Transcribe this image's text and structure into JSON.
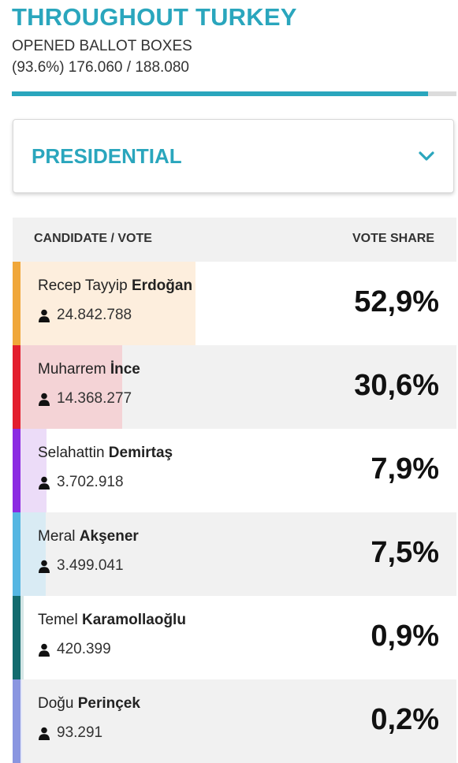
{
  "header": {
    "title": "THROUGHOUT TURKEY",
    "subtitle": "OPENED BALLOT BOXES",
    "counts": "(93.6%) 176.060 / 188.080",
    "progress_percent": 93.6
  },
  "dropdown": {
    "selected": "PRESIDENTIAL",
    "icon": "chevron-down-icon"
  },
  "table": {
    "col_candidate": "CANDIDATE / VOTE",
    "col_share": "VOTE SHARE",
    "rows": [
      {
        "first": "Recep Tayyip",
        "last": "Erdoğan",
        "votes": "24.842.788",
        "share": "52,9%",
        "share_value": 52.9,
        "color": "#f0a73a",
        "tint": "#fdeedd"
      },
      {
        "first": "Muharrem",
        "last": "İnce",
        "votes": "14.368.277",
        "share": "30,6%",
        "share_value": 30.6,
        "color": "#e31e2e",
        "tint": "#f4d3d6"
      },
      {
        "first": "Selahattin",
        "last": "Demirtaş",
        "votes": "3.702.918",
        "share": "7,9%",
        "share_value": 7.9,
        "color": "#8b2be2",
        "tint": "#ecdcf8"
      },
      {
        "first": "Meral",
        "last": "Akşener",
        "votes": "3.499.041",
        "share": "7,5%",
        "share_value": 7.5,
        "color": "#55b6e2",
        "tint": "#d9ebf4"
      },
      {
        "first": "Temel",
        "last": "Karamollaoğlu",
        "votes": "420.399",
        "share": "0,9%",
        "share_value": 0.9,
        "color": "#136b6e",
        "tint": "#d4e6e6"
      },
      {
        "first": "Doğu",
        "last": "Perinçek",
        "votes": "93.291",
        "share": "0,2%",
        "share_value": 0.2,
        "color": "#8a96e0",
        "tint": "#e4e7f8"
      }
    ]
  }
}
